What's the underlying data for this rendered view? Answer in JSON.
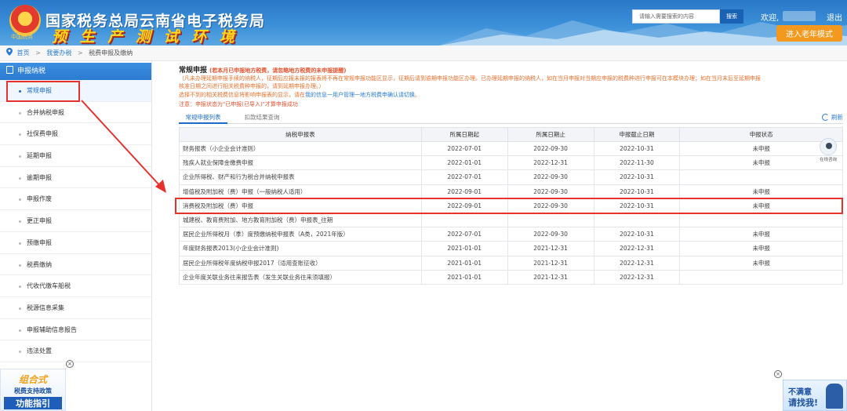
{
  "header": {
    "emblem_caption": "中国税务",
    "title": "国家税务总局云南省电子税务局",
    "subtitle": "预 生 产 测 试 环 境",
    "search_placeholder": "请输入需要搜索的内容",
    "search_button": "搜索",
    "welcome": "欢迎,",
    "logout": "退出",
    "elder_mode": "进入老年模式"
  },
  "breadcrumb": {
    "home": "首页",
    "sep1": ">",
    "my_office": "我要办税",
    "sep2": ">",
    "current": "税费申报及缴纳"
  },
  "sidebar": {
    "header": "申报纳税",
    "items": [
      {
        "label": "常规申报"
      },
      {
        "label": "合并纳税申报"
      },
      {
        "label": "社保费申报"
      },
      {
        "label": "延期申报"
      },
      {
        "label": "逾期申报"
      },
      {
        "label": "申报作废"
      },
      {
        "label": "更正申报"
      },
      {
        "label": "预缴申报"
      },
      {
        "label": "税费缴纳"
      },
      {
        "label": "代收代缴车船税"
      },
      {
        "label": "税源信息采集"
      },
      {
        "label": "申报辅助信息报告"
      },
      {
        "label": "违法处置"
      }
    ]
  },
  "promo_left": {
    "line1": "组合式",
    "line2": "税费支持政策",
    "line3": "功能指引",
    "close": "×"
  },
  "main": {
    "title": "常规申报",
    "title_note": "(若本月已申报地方税费，请忽略地方税费的未申报提醒)",
    "notice1": "（凡未办理延期申报手续的纳税人，征期后应报未报的报表将不再在常规申报功能区显示，征期后请到逾期申报功能区办理。已办理延期申报的纳税人，如在当月申报对当期应申报的税费种进行申报可在本模块办理；如在当月末后至延期申报",
    "notice2": "核准日期之间进行相关税费种申报的，请到延期申报办理。）",
    "notice3_pre": "选择不到的相关税费信息将影响申报表的显示，请在",
    "notice3_link": "我的信息一用户管理一地方税费申确认请切换",
    "notice3_post": "。",
    "notice4": "注意：申报状态为\"已申报(已导入)\"才算申报成功",
    "tab_active": "常规申报列表",
    "tab_other": "扣款结果查询",
    "refresh": "刷新"
  },
  "table": {
    "headers": [
      "纳税申报表",
      "所属日期起",
      "所属日期止",
      "申报截止日期",
      "申报状态"
    ],
    "rows": [
      [
        "财务报表（小企业会计准则）",
        "2022-07-01",
        "2022-09-30",
        "2022-10-31",
        "未申报"
      ],
      [
        "残疾人就业保障金缴费申报",
        "2022-01-01",
        "2022-12-31",
        "2022-11-30",
        "未申报"
      ],
      [
        "企业所得税、财产和行为税合并纳税申报表",
        "2022-07-01",
        "2022-09-30",
        "2022-10-31",
        ""
      ],
      [
        "增值税及附加税（费）申报（一般纳税人适用）",
        "2022-09-01",
        "2022-09-30",
        "2022-10-31",
        "未申报"
      ],
      [
        "消费税及附加税（费）申报",
        "2022-09-01",
        "2022-09-30",
        "2022-10-31",
        "未申报"
      ],
      [
        "城建税、教育费附加、地方教育附加税（费）申报表_往期",
        "",
        "",
        "",
        ""
      ],
      [
        "居民企业所得税月（季）度预缴纳税申报表（A类，2021年版）",
        "2022-07-01",
        "2022-09-30",
        "2022-10-31",
        "未申报"
      ],
      [
        "年度财务报表2013(小企业会计准则)",
        "2021-01-01",
        "2021-12-31",
        "2022-12-31",
        "未申报"
      ],
      [
        "居民企业所得税年度纳税申报2017（适用查账征收）",
        "2021-01-01",
        "2021-12-31",
        "2022-12-31",
        "未申报"
      ],
      [
        "企业年度关联业务往来报告表（发生关联业务往来须填报）",
        "2021-01-01",
        "2021-12-31",
        "2022-12-31",
        ""
      ]
    ]
  },
  "service": {
    "label": "在线咨询"
  },
  "promo_right": {
    "line1": "不满意",
    "line2": "请找我!",
    "close": "×"
  },
  "colors": {
    "brand_blue": "#2b7bd1",
    "highlight_red": "#e8302c",
    "notice_orange": "#e8702c",
    "elder_button": "#f39a1e"
  }
}
